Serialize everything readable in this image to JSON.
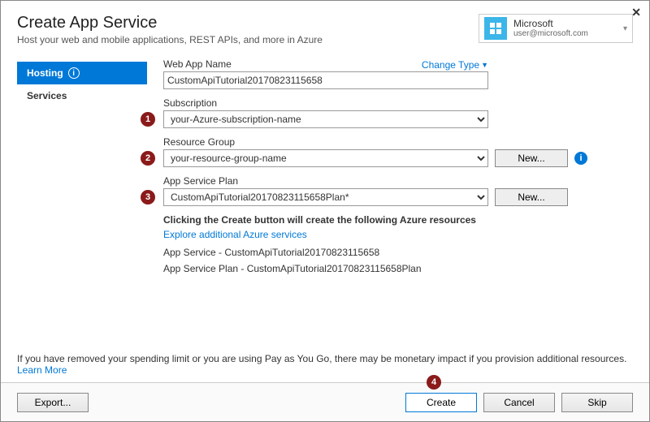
{
  "window": {
    "title": "Create App Service",
    "subtitle": "Host your web and mobile applications, REST APIs, and more in Azure"
  },
  "account": {
    "name": "Microsoft",
    "email": "user@microsoft.com"
  },
  "sidebar": {
    "items": [
      {
        "label": "Hosting",
        "active": true
      },
      {
        "label": "Services",
        "active": false
      }
    ]
  },
  "changeType": "Change Type",
  "fields": {
    "webAppName": {
      "label": "Web App Name",
      "value": "CustomApiTutorial20170823115658"
    },
    "subscription": {
      "label": "Subscription",
      "value": "your-Azure-subscription-name",
      "marker": "1"
    },
    "resourceGroup": {
      "label": "Resource Group",
      "value": "your-resource-group-name",
      "newBtn": "New...",
      "marker": "2"
    },
    "appServicePlan": {
      "label": "App Service Plan",
      "value": "CustomApiTutorial20170823115658Plan*",
      "newBtn": "New...",
      "marker": "3"
    }
  },
  "summary": {
    "heading": "Clicking the Create button will create the following Azure resources",
    "link": "Explore additional Azure services",
    "line1": "App Service - CustomApiTutorial20170823115658",
    "line2": "App Service Plan - CustomApiTutorial20170823115658Plan"
  },
  "note": {
    "text": "If you have removed your spending limit or you are using Pay as You Go, there may be monetary impact if you provision additional resources.",
    "learn": "Learn More"
  },
  "footer": {
    "export": "Export...",
    "create": "Create",
    "cancel": "Cancel",
    "skip": "Skip",
    "createMarker": "4"
  }
}
